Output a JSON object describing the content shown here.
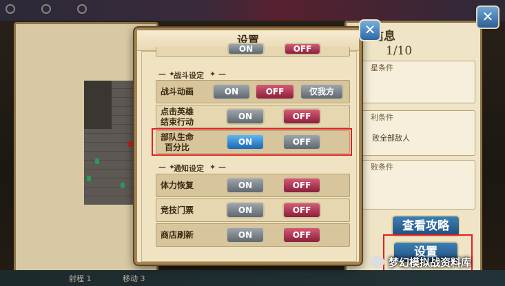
{
  "dialog": {
    "title": "设置",
    "top_row_off": "OFF",
    "top_row_on": "ON",
    "sections": {
      "battle_header": "战斗设定",
      "notify_header": "通知设定"
    },
    "rows": {
      "battle_anim": {
        "label": "战斗动画",
        "on": "ON",
        "off": "OFF",
        "third": "仅我方"
      },
      "tap_hero": {
        "label_line1": "点击英雄",
        "label_line2": "结束行动",
        "on": "ON",
        "off": "OFF"
      },
      "troop_hp": {
        "label_line1": "部队生命",
        "label_line2": "百分比",
        "on": "ON",
        "off": "OFF"
      },
      "stamina": {
        "label": "体力恢复",
        "on": "ON",
        "off": "OFF"
      },
      "arena": {
        "label": "竞技门票",
        "on": "ON",
        "off": "OFF"
      },
      "shop": {
        "label": "商店刷新",
        "on": "ON",
        "off": "OFF"
      }
    }
  },
  "right_panel": {
    "title": "信息",
    "page": "1/10",
    "star_label": "星条件",
    "win_label": "利条件",
    "win_text": "败全部敌人",
    "lose_label": "败条件",
    "guide_button": "查看攻略",
    "settings_button": "设置"
  },
  "bottom_bar": {
    "left_text": "射程 1",
    "mid_text": "移动 3"
  },
  "watermark": "梦幻模拟战资料库",
  "colors": {
    "highlight": "#e02020",
    "on_active": "#1b66b4",
    "off_red": "#8a1f3a"
  }
}
